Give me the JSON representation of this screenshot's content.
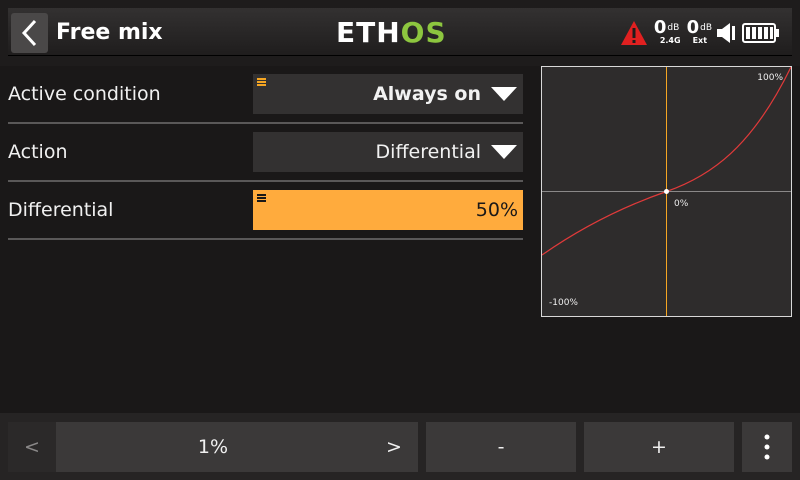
{
  "header": {
    "title": "Free mix",
    "logo_a": "ETH",
    "logo_b": "OS",
    "rssi_int": {
      "value": "0",
      "unit": "dB",
      "label": "2.4G"
    },
    "rssi_ext": {
      "value": "0",
      "unit": "dB",
      "label": "Ext"
    }
  },
  "form": {
    "active_condition": {
      "label": "Active condition",
      "value": "Always on"
    },
    "action": {
      "label": "Action",
      "value": "Differential"
    },
    "differential": {
      "label": "Differential",
      "value": "50%"
    }
  },
  "curve": {
    "max_label": "100%",
    "min_label": "-100%",
    "center_label": "0%",
    "colors": {
      "curve": "#e03a3a",
      "center_v": "#f5a623",
      "center_h": "#8a8888"
    }
  },
  "bottom": {
    "prev_label": "<",
    "step_value": "1%",
    "next_label": ">",
    "minus_label": "-",
    "plus_label": "+"
  },
  "colors": {
    "accent": "#ffab3d",
    "logo_green": "#8dc63f",
    "warning": "#e02020"
  }
}
